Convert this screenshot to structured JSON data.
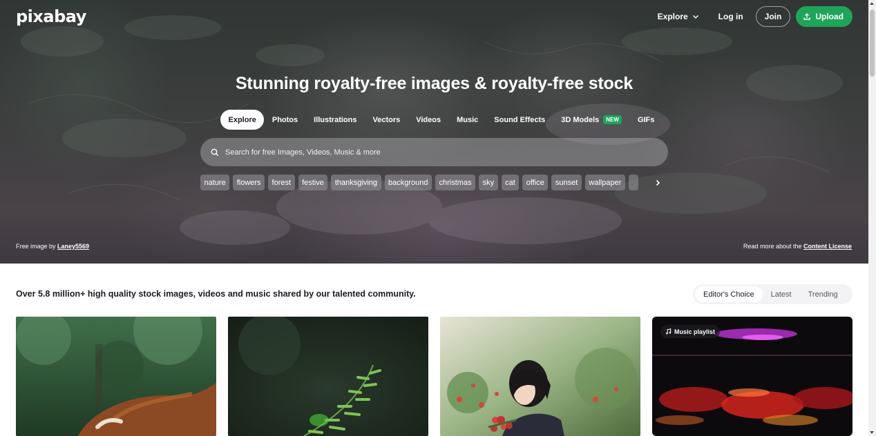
{
  "brand": {
    "logo": "pixabay"
  },
  "topnav": {
    "explore_label": "Explore",
    "login_label": "Log in",
    "join_label": "Join",
    "upload_label": "Upload",
    "upload_color": "#1ea55a"
  },
  "hero": {
    "title": "Stunning royalty-free images & royalty-free stock",
    "tabs": [
      {
        "label": "Explore",
        "active": true
      },
      {
        "label": "Photos"
      },
      {
        "label": "Illustrations"
      },
      {
        "label": "Vectors"
      },
      {
        "label": "Videos"
      },
      {
        "label": "Music"
      },
      {
        "label": "Sound Effects"
      },
      {
        "label": "3D Models",
        "badge": "NEW"
      },
      {
        "label": "GIFs"
      }
    ],
    "search": {
      "placeholder": "Search for free Images, Videos, Music & more",
      "icon": "search-icon"
    },
    "chips": [
      "nature",
      "flowers",
      "forest",
      "festive",
      "thanksgiving",
      "background",
      "christmas",
      "sky",
      "cat",
      "office",
      "sunset",
      "wallpaper"
    ],
    "credit": {
      "prefix": "Free image by ",
      "author": "Laney5569"
    },
    "license": {
      "prefix": "Read more about the ",
      "link": "Content License"
    }
  },
  "content": {
    "tagline": "Over 5.8 million+ high quality stock images, videos and music shared by our talented community.",
    "sort_options": [
      {
        "label": "Editor's Choice",
        "active": true
      },
      {
        "label": "Latest"
      },
      {
        "label": "Trending"
      }
    ],
    "cards": [
      {
        "subject": "highland-cow"
      },
      {
        "subject": "fern"
      },
      {
        "subject": "woman-with-flowers"
      },
      {
        "subject": "music-playlist",
        "badge": "Music playlist",
        "badge_icon": "music-note-icon"
      }
    ]
  },
  "colors": {
    "accent": "#1ea55a",
    "text": "#191b26"
  }
}
